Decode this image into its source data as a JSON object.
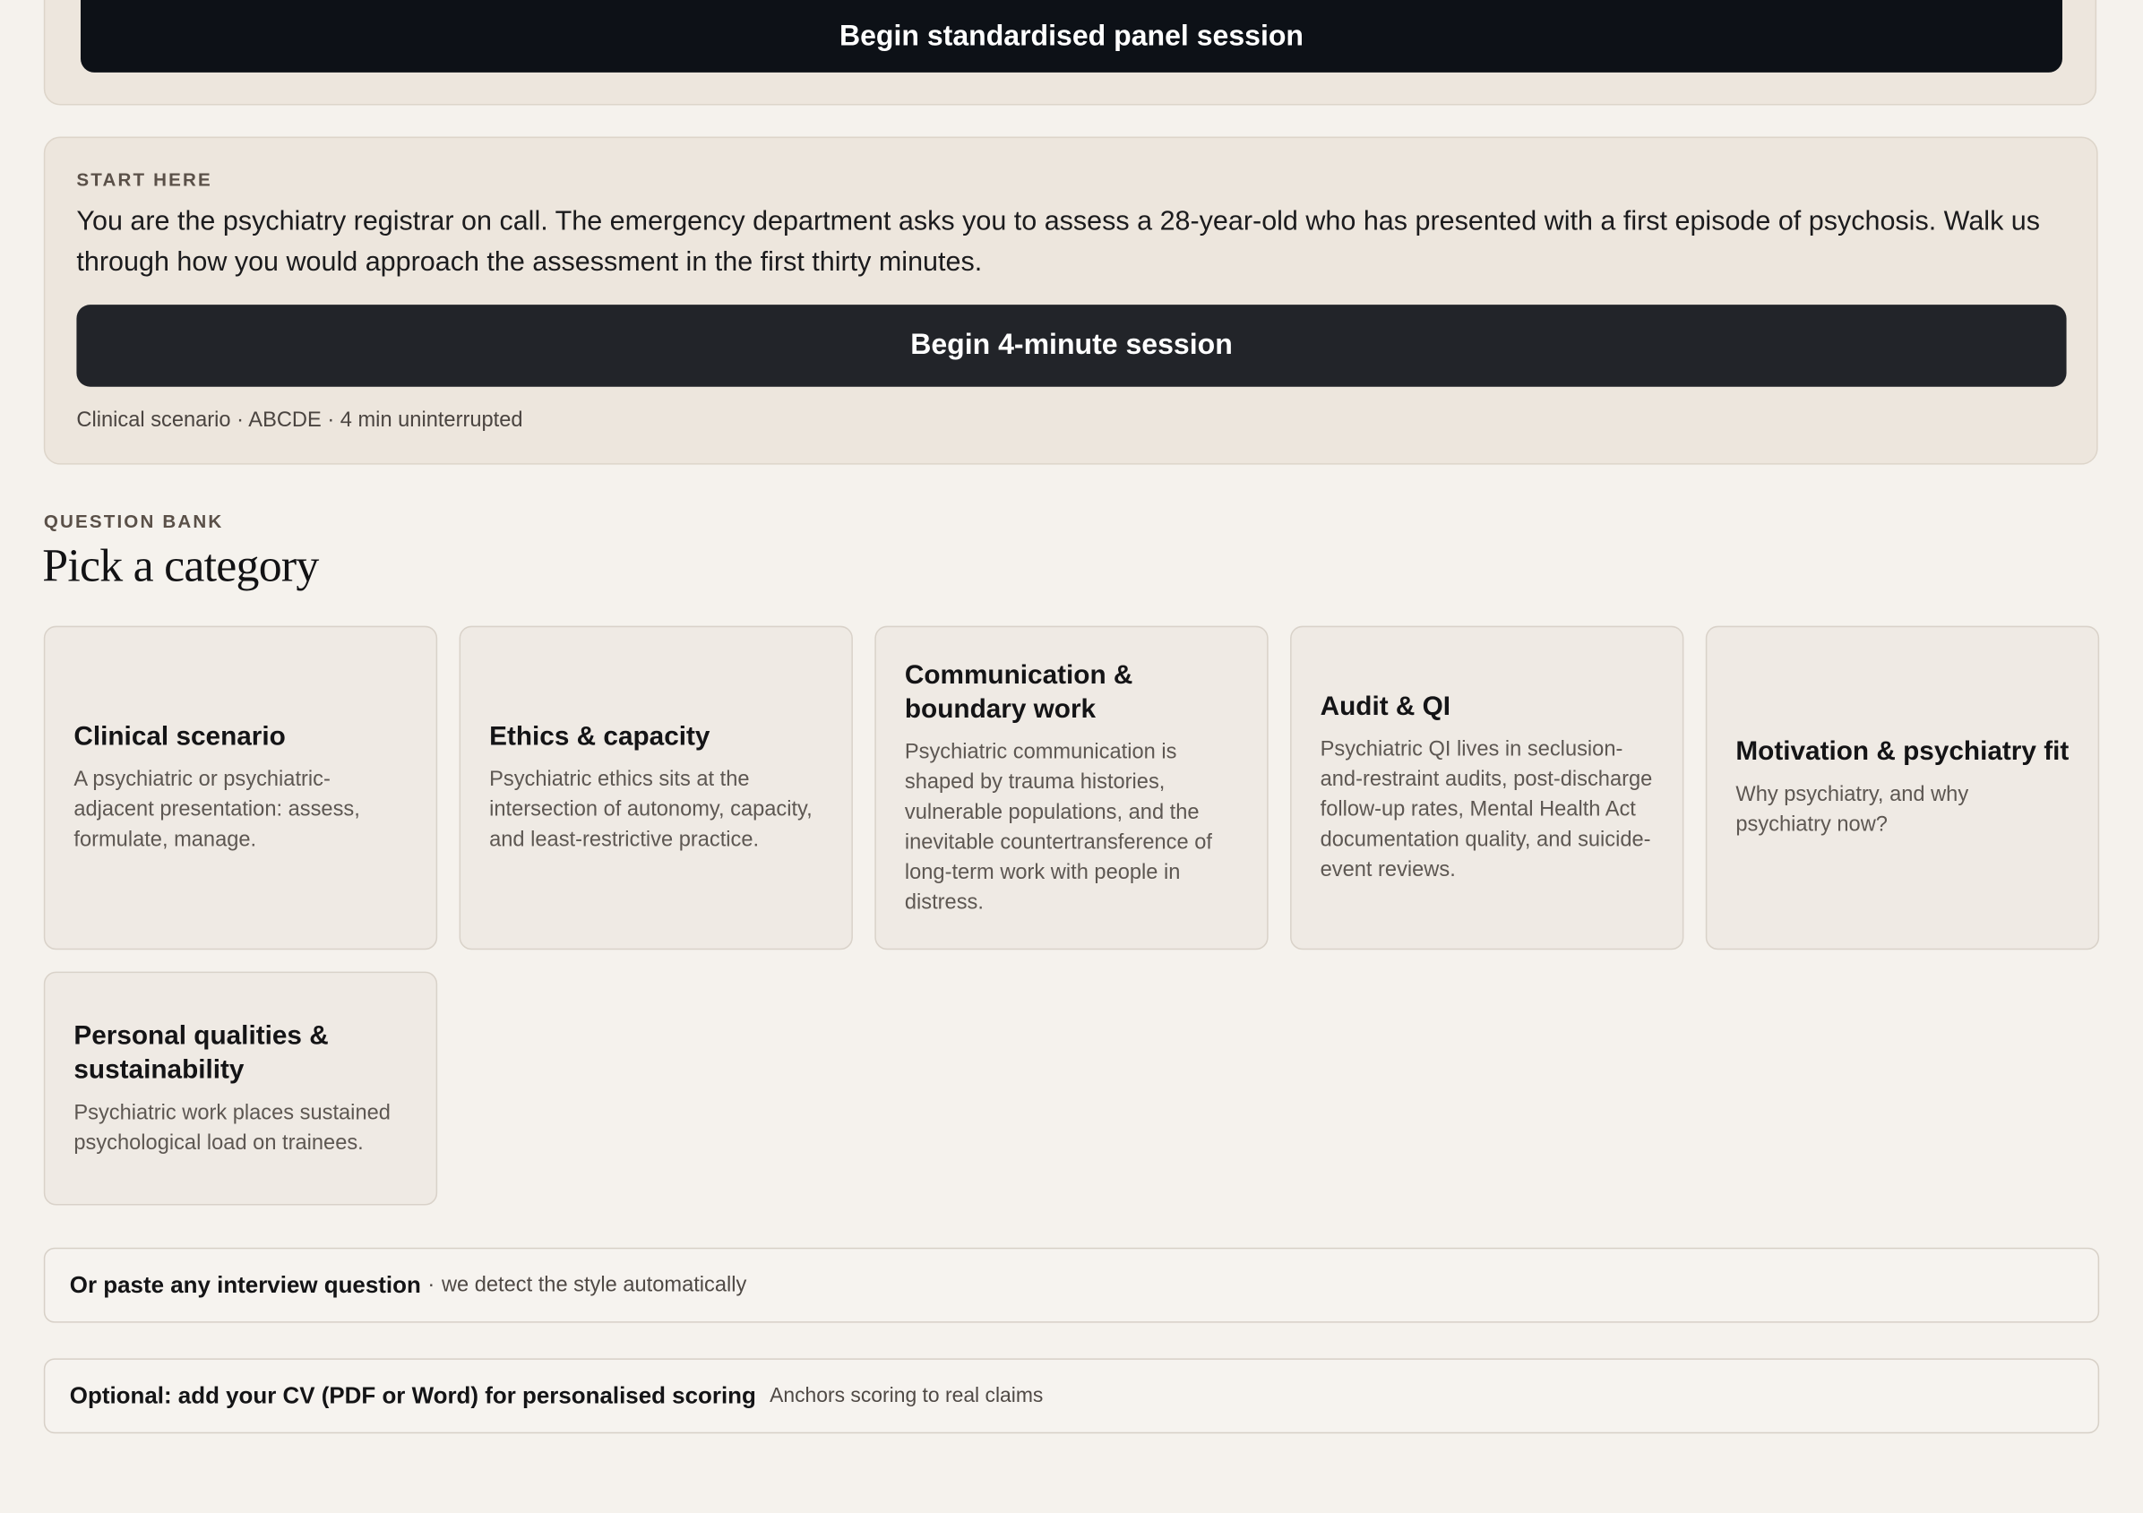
{
  "top_panel": {
    "button_label": "Begin standardised panel session"
  },
  "start_here": {
    "eyebrow": "START HERE",
    "prompt": "You are the psychiatry registrar on call. The emergency department asks you to assess a 28-year-old who has presented with a first episode of psychosis. Walk us through how you would approach the assessment in the first thirty minutes.",
    "button_label": "Begin 4-minute session",
    "meta": "Clinical scenario · ABCDE · 4 min uninterrupted"
  },
  "question_bank": {
    "eyebrow": "QUESTION BANK",
    "title": "Pick a category",
    "categories": [
      {
        "title": "Clinical scenario",
        "description": "A psychiatric or psychiatric-adjacent presentation: assess, formulate, manage."
      },
      {
        "title": "Ethics & capacity",
        "description": "Psychiatric ethics sits at the intersection of autonomy, capacity, and least-restrictive practice."
      },
      {
        "title": "Communication & boundary work",
        "description": "Psychiatric communication is shaped by trauma histories, vulnerable populations, and the inevitable countertransference of long-term work with people in distress."
      },
      {
        "title": "Audit & QI",
        "description": "Psychiatric QI lives in seclusion-and-restraint audits, post-discharge follow-up rates, Mental Health Act documentation quality, and suicide-event reviews."
      },
      {
        "title": "Motivation & psychiatry fit",
        "description": "Why psychiatry, and why psychiatry now?"
      },
      {
        "title": "Personal qualities & sustainability",
        "description": "Psychiatric work places sustained psychological load on trainees."
      }
    ]
  },
  "paste_question": {
    "label": "Or paste any interview question",
    "separator": "·",
    "hint": "we detect the style automatically"
  },
  "cv_upload": {
    "label": "Optional: add your CV (PDF or Word) for personalised scoring",
    "hint": "Anchors scoring to real claims"
  }
}
